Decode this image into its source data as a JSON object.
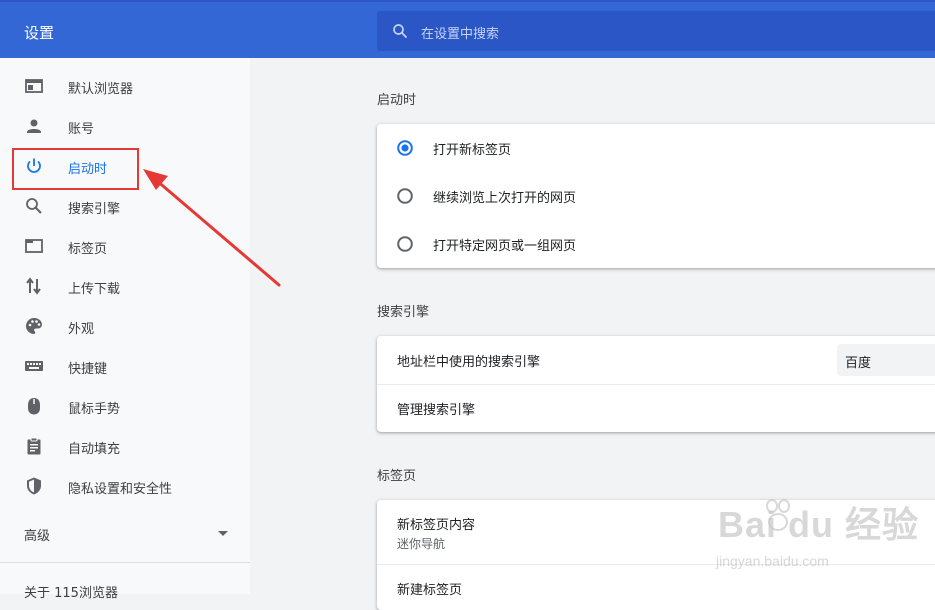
{
  "header": {
    "title": "设置"
  },
  "search": {
    "placeholder": "在设置中搜索"
  },
  "sidebar": {
    "items": [
      {
        "label": "默认浏览器",
        "icon": "browser-window-icon"
      },
      {
        "label": "账号",
        "icon": "person-icon"
      },
      {
        "label": "启动时",
        "icon": "power-icon",
        "active": true
      },
      {
        "label": "搜索引擎",
        "icon": "search-icon"
      },
      {
        "label": "标签页",
        "icon": "tab-icon"
      },
      {
        "label": "上传下载",
        "icon": "upload-download-icon"
      },
      {
        "label": "外观",
        "icon": "palette-icon"
      },
      {
        "label": "快捷键",
        "icon": "keyboard-icon"
      },
      {
        "label": "鼠标手势",
        "icon": "mouse-icon"
      },
      {
        "label": "自动填充",
        "icon": "clipboard-icon"
      },
      {
        "label": "隐私设置和安全性",
        "icon": "shield-icon"
      }
    ],
    "advanced_label": "高级",
    "about_label": "关于 115浏览器"
  },
  "startup": {
    "title": "启动时",
    "options": [
      {
        "label": "打开新标签页",
        "selected": true
      },
      {
        "label": "继续浏览上次打开的网页",
        "selected": false
      },
      {
        "label": "打开特定网页或一组网页",
        "selected": false
      }
    ]
  },
  "search_engine": {
    "title": "搜索引擎",
    "address_bar_label": "地址栏中使用的搜索引擎",
    "selected_engine": "百度",
    "manage_label": "管理搜索引擎"
  },
  "tabs": {
    "title": "标签页",
    "new_tab_content_label": "新标签页内容",
    "new_tab_content_value": "迷你导航",
    "new_tab_label": "新建标签页"
  },
  "watermark": {
    "text": "Bai du 经验",
    "url": "jingyan.baidu.com"
  },
  "colors": {
    "header_bg": "#3367d6",
    "accent": "#1a73e8",
    "annotation_red": "#e53935"
  }
}
